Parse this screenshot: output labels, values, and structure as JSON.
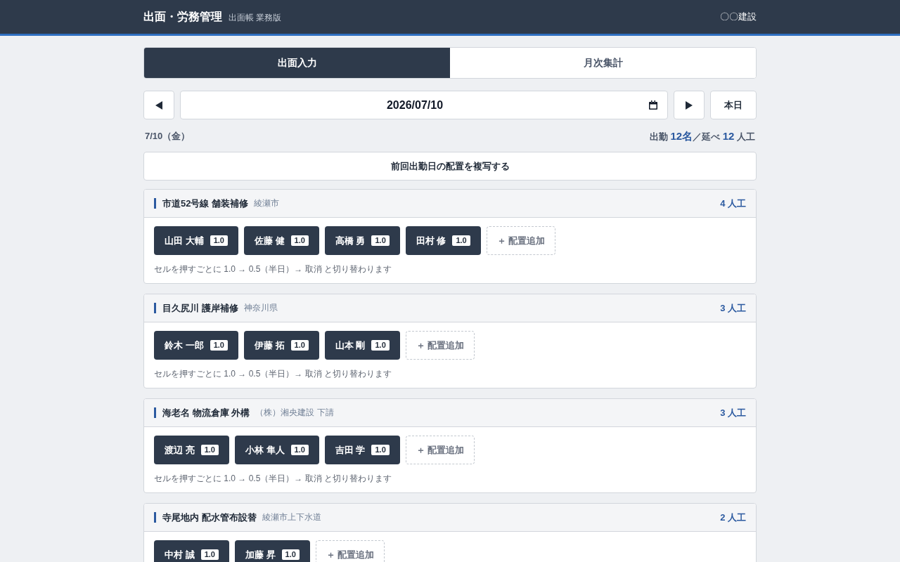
{
  "header": {
    "title": "出面・労務管理",
    "subtitle": "出面帳 業務版",
    "company": "〇〇建設"
  },
  "tabs": [
    {
      "label": "出面入力",
      "selected": true
    },
    {
      "label": "月次集計",
      "selected": false
    }
  ],
  "date_nav": {
    "date": "2026/07/10",
    "today_button": "本日"
  },
  "summary": {
    "day": "7/10（金）",
    "totals": "出勤 **12名**／延べ **12** 人工"
  },
  "copy_button": "前回出勤日の配置を複写する",
  "sites": [
    {
      "name": "市道52号線 舗装補修",
      "client": "綾瀬市",
      "total": "4 人工",
      "workers": [
        {
          "name": "山田 大輔",
          "value": "1.0"
        },
        {
          "name": "佐藤 健",
          "value": "1.0"
        },
        {
          "name": "高橋 勇",
          "value": "1.0"
        },
        {
          "name": "田村 修",
          "value": "1.0"
        }
      ],
      "add_button": "＋ 配置追加",
      "hint": "セルを押すごとに 1.0 → 0.5（半日）→ 取消 と切り替わります"
    },
    {
      "name": "目久尻川 護岸補修",
      "client": "神奈川県",
      "total": "3 人工",
      "workers": [
        {
          "name": "鈴木 一郎",
          "value": "1.0"
        },
        {
          "name": "伊藤 拓",
          "value": "1.0"
        },
        {
          "name": "山本 剛",
          "value": "1.0"
        }
      ],
      "add_button": "＋ 配置追加",
      "hint": "セルを押すごとに 1.0 → 0.5（半日）→ 取消 と切り替わります"
    },
    {
      "name": "海老名 物流倉庫 外構",
      "client": "（株）湘央建設 下請",
      "total": "3 人工",
      "workers": [
        {
          "name": "渡辺 亮",
          "value": "1.0"
        },
        {
          "name": "小林 隼人",
          "value": "1.0"
        },
        {
          "name": "吉田 学",
          "value": "1.0"
        }
      ],
      "add_button": "＋ 配置追加",
      "hint": "セルを押すごとに 1.0 → 0.5（半日）→ 取消 と切り替わります"
    },
    {
      "name": "寺尾地内 配水管布設替",
      "client": "綾瀬市上下水道",
      "total": "2 人工",
      "workers": [
        {
          "name": "中村 誠",
          "value": "1.0"
        },
        {
          "name": "加藤 昇",
          "value": "1.0"
        }
      ],
      "add_button": "＋ 配置追加"
    }
  ]
}
